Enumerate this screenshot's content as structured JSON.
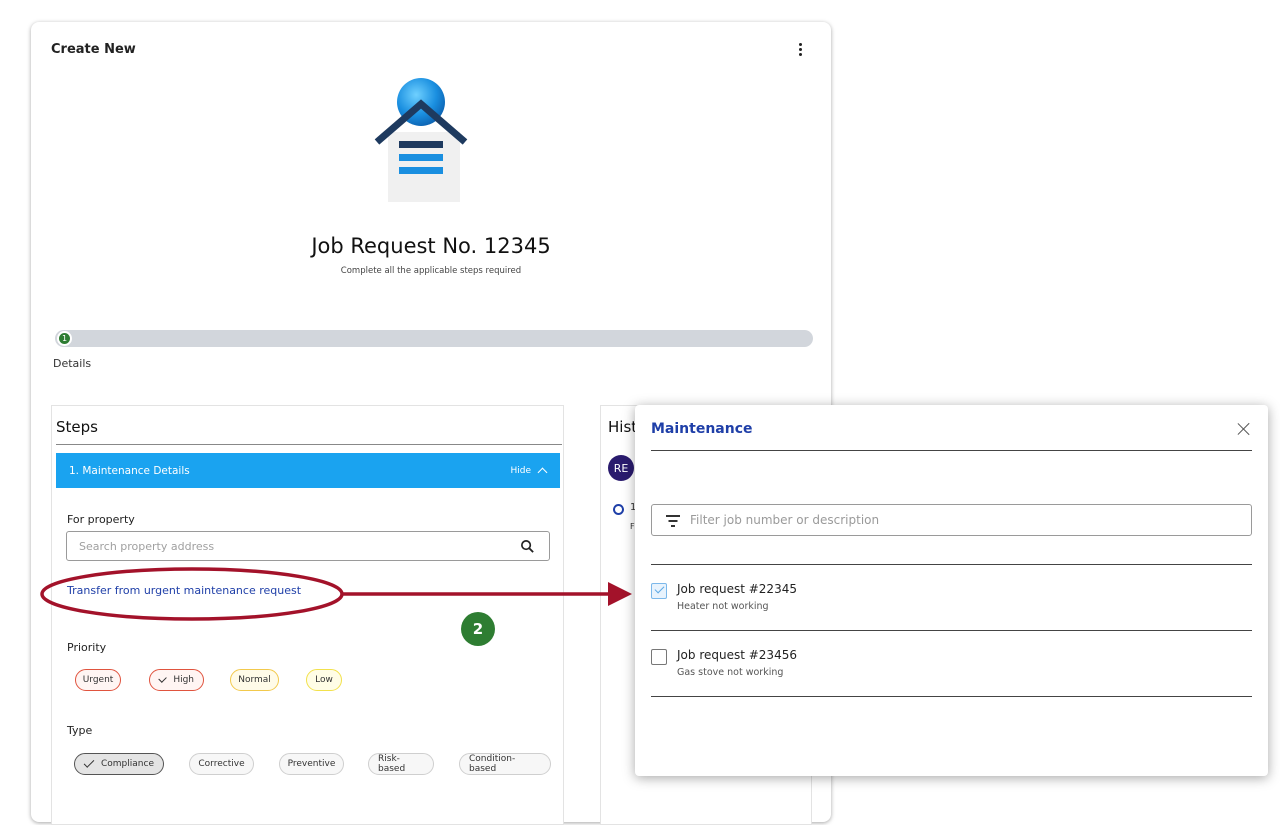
{
  "card": {
    "title": "Create New"
  },
  "job": {
    "title": "Job Request No. 12345",
    "subtitle": "Complete all the applicable steps required"
  },
  "progress": {
    "step_number": "1",
    "step_label": "Details"
  },
  "steps": {
    "heading": "Steps",
    "accordion": {
      "title": "1. Maintenance Details",
      "hide_label": "Hide"
    },
    "for_property_label": "For property",
    "search_placeholder": "Search property address",
    "transfer_link": "Transfer from urgent maintenance request",
    "priority_label": "Priority",
    "priorities": [
      "Urgent",
      "High",
      "Normal",
      "Low"
    ],
    "priority_selected": "High",
    "type_label": "Type",
    "types": [
      "Compliance",
      "Corrective",
      "Preventive",
      "Risk-based",
      "Condition-based"
    ],
    "type_selected": "Compliance"
  },
  "history": {
    "heading_fragment": "Hist",
    "avatar_initials": "RE",
    "entry_fragment_1": "1",
    "entry_fragment_2": "F"
  },
  "annotation": {
    "badge": "2",
    "color_arrow": "#a3122a",
    "color_badge": "#2e7d32"
  },
  "modal": {
    "title": "Maintenance",
    "filter_placeholder": "Filter job number or description",
    "items": [
      {
        "name": "Job request #22345",
        "description": "Heater not working",
        "checked": true
      },
      {
        "name": "Job request #23456",
        "description": "Gas stove not working",
        "checked": false
      }
    ]
  },
  "colors": {
    "accent_blue": "#1aa3f0",
    "link_blue": "#1f3fa8",
    "success_green": "#2e7d32"
  },
  "icons": {
    "kebab": "more-vert-icon",
    "search": "search-icon",
    "chevron": "chevron-up-icon",
    "close": "close-icon",
    "filter": "filter-icon",
    "check": "check-icon"
  }
}
